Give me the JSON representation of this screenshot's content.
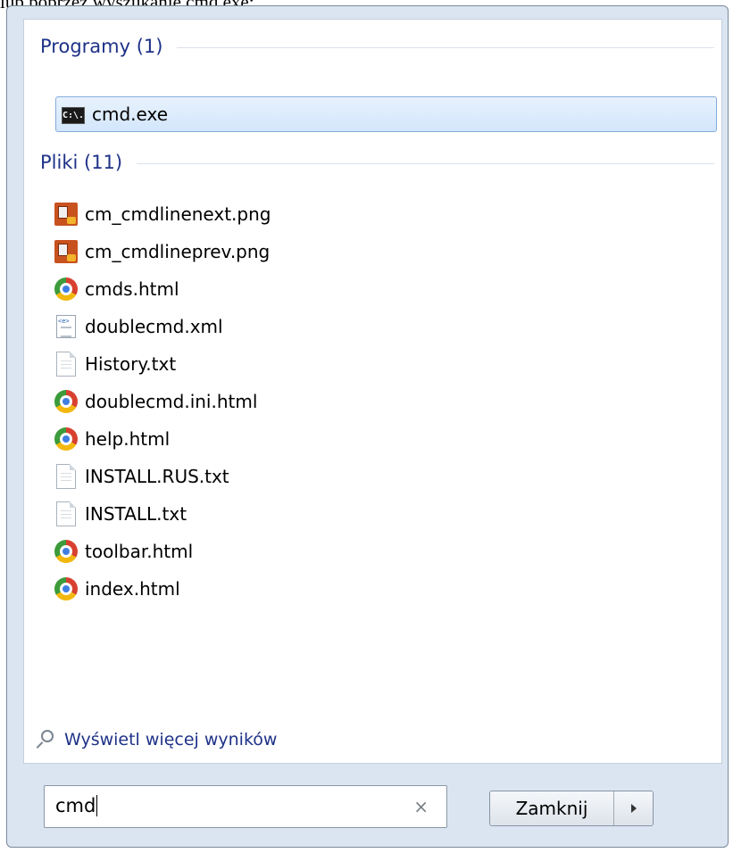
{
  "caption": "lub poprzez wyszukanie cmd.exe:",
  "groups": {
    "programs": {
      "title": "Programy (1)",
      "items": [
        {
          "label": "cmd.exe",
          "icon": "cmd-icon",
          "selected": true
        }
      ]
    },
    "files": {
      "title": "Pliki (11)",
      "items": [
        {
          "label": "cm_cmdlinenext.png",
          "icon": "png-icon"
        },
        {
          "label": "cm_cmdlineprev.png",
          "icon": "png-icon"
        },
        {
          "label": "cmds.html",
          "icon": "chrome-icon"
        },
        {
          "label": "doublecmd.xml",
          "icon": "xml-icon"
        },
        {
          "label": "History.txt",
          "icon": "txt-icon"
        },
        {
          "label": "doublecmd.ini.html",
          "icon": "chrome-icon"
        },
        {
          "label": "help.html",
          "icon": "chrome-icon"
        },
        {
          "label": "INSTALL.RUS.txt",
          "icon": "txt-icon"
        },
        {
          "label": "INSTALL.txt",
          "icon": "txt-icon"
        },
        {
          "label": "toolbar.html",
          "icon": "chrome-icon"
        },
        {
          "label": "index.html",
          "icon": "chrome-icon"
        }
      ]
    }
  },
  "more_results": {
    "label": "Wyświetl więcej wyników",
    "icon": "search-icon"
  },
  "search": {
    "value": "cmd",
    "clear_icon": "close-icon",
    "clear_glyph": "×"
  },
  "shutdown": {
    "label": "Zamknij",
    "arrow_icon": "chevron-right-icon"
  },
  "colors": {
    "group_title": "#1e3287",
    "selection_border": "#84acdd",
    "panel_bg": "#dbe5f1"
  }
}
